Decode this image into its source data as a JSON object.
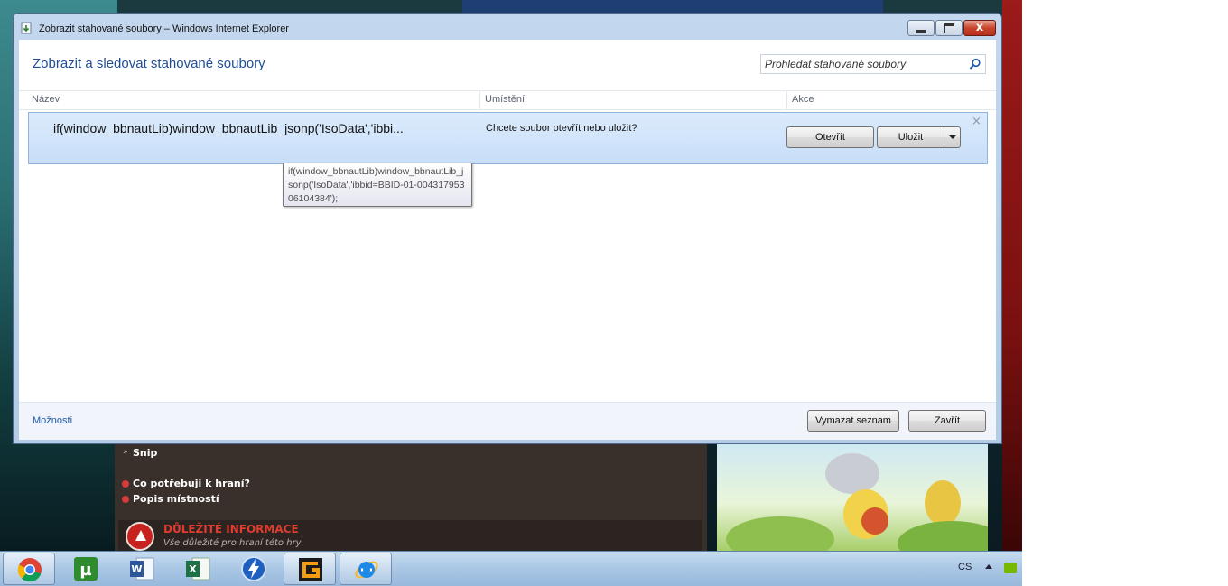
{
  "window": {
    "title": "Zobrazit stahované soubory – Windows Internet Explorer",
    "heading": "Zobrazit a sledovat stahované soubory",
    "search_placeholder": "Prohledat stahované soubory",
    "columns": [
      "Název",
      "Umístění",
      "Akce"
    ],
    "download": {
      "name": "if(window_bbnautLib)window_bbnautLib_jsonp('IsoData','ibbi...",
      "status": "Chcete soubor otevřít nebo uložit?",
      "open_label": "Otevřít",
      "save_label": "Uložit",
      "dismiss_label": "×",
      "tooltip": "if(window_bbnautLib)window_bbnautLib_jsonp('IsoData','ibbid=BBID-01-00431795306104384');"
    },
    "footer": {
      "options_label": "Možnosti",
      "clear_label": "Vymazat seznam",
      "close_label": "Zavřít"
    },
    "close_glyph": "x"
  },
  "background_page": {
    "links": [
      "Snip",
      "Co potřebuji k hraní?",
      "Popis místností"
    ],
    "info_title": "DŮLEŽITÉ INFORMACE",
    "info_subtitle": "Vše důležité pro hraní této hry"
  },
  "taskbar": {
    "apps": [
      {
        "icon": "chrome-icon",
        "name": "taskbar-chrome"
      },
      {
        "icon": "utorrent-icon",
        "name": "taskbar-utorrent"
      },
      {
        "icon": "word-icon",
        "name": "taskbar-word"
      },
      {
        "icon": "excel-icon",
        "name": "taskbar-excel"
      },
      {
        "icon": "flashget-icon",
        "name": "taskbar-flashget"
      },
      {
        "icon": "gameranger-icon",
        "name": "taskbar-gamer"
      },
      {
        "icon": "internet-explorer-icon",
        "name": "taskbar-ie"
      }
    ],
    "language": "CS"
  },
  "colors": {
    "heading": "#1e4d95",
    "row_highlight": "#c7def8",
    "link": "#1e5aa8",
    "info_red": "#e23b2f"
  }
}
